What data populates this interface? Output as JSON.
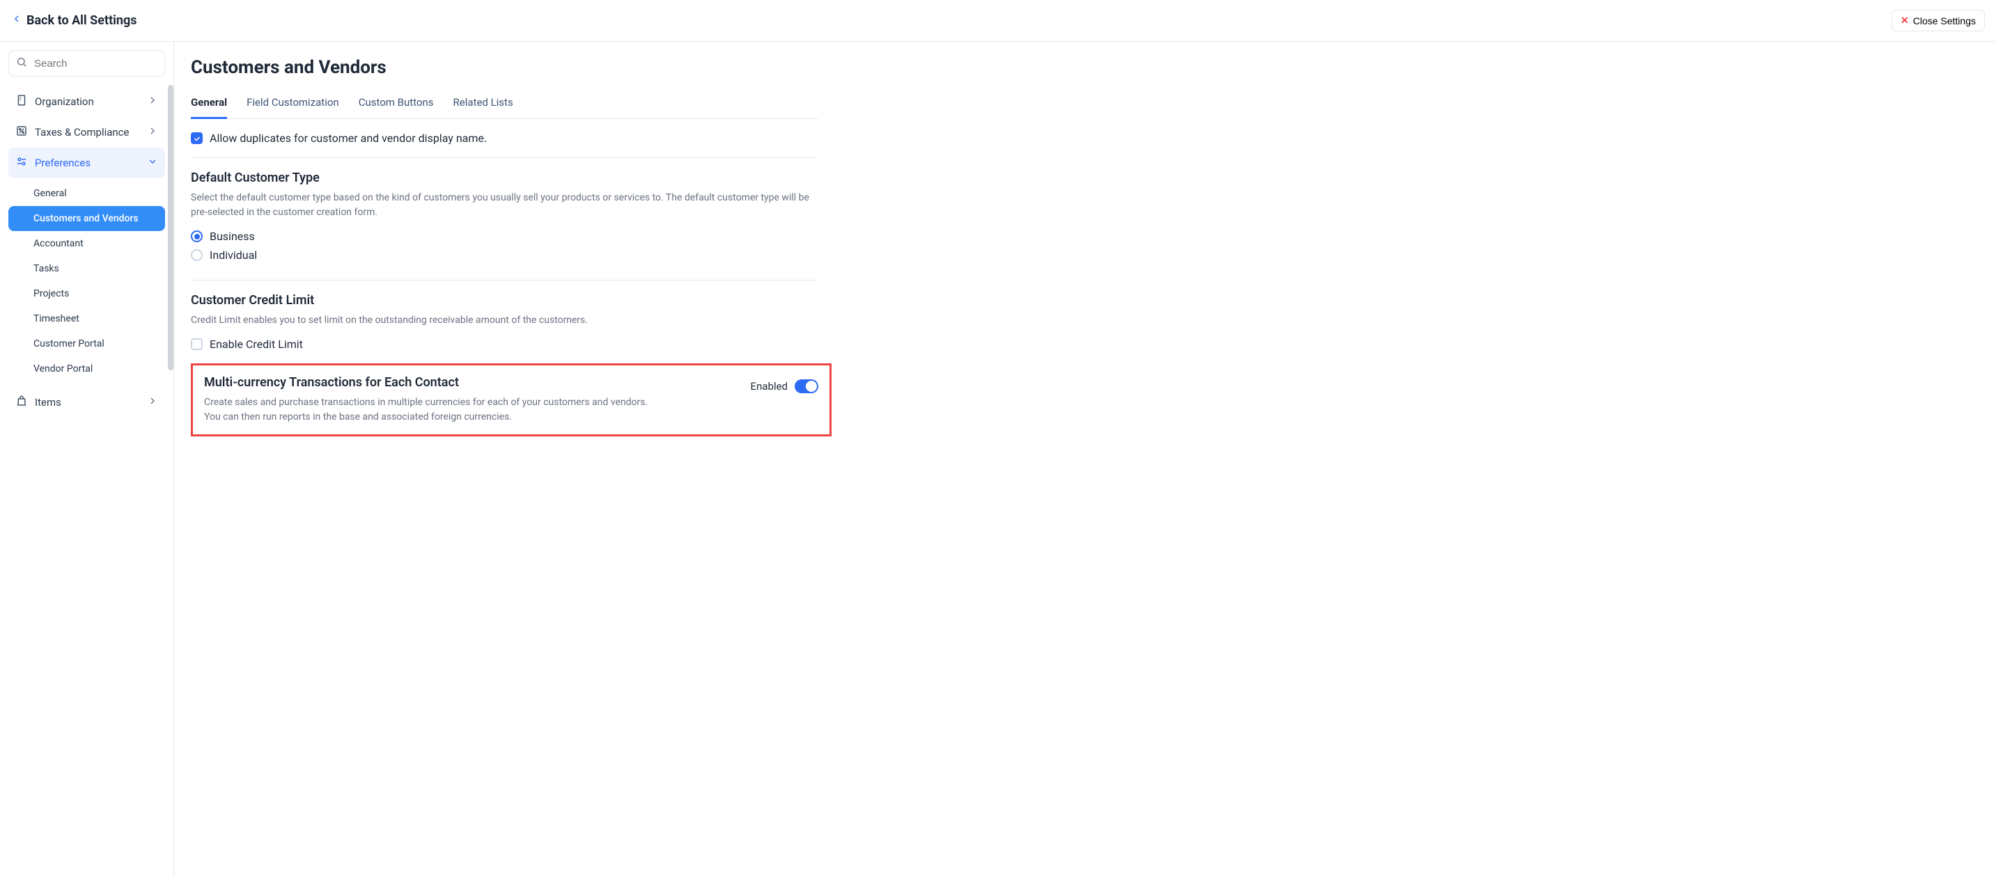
{
  "header": {
    "back_label": "Back to All Settings",
    "close_label": "Close Settings"
  },
  "search": {
    "placeholder": "Search"
  },
  "sidebar": {
    "items": [
      {
        "label": "Organization"
      },
      {
        "label": "Taxes & Compliance"
      },
      {
        "label": "Preferences"
      },
      {
        "label": "Items"
      }
    ],
    "preferences_sub": [
      {
        "label": "General"
      },
      {
        "label": "Customers and Vendors"
      },
      {
        "label": "Accountant"
      },
      {
        "label": "Tasks"
      },
      {
        "label": "Projects"
      },
      {
        "label": "Timesheet"
      },
      {
        "label": "Customer Portal"
      },
      {
        "label": "Vendor Portal"
      }
    ]
  },
  "main": {
    "title": "Customers and Vendors",
    "tabs": [
      "General",
      "Field Customization",
      "Custom Buttons",
      "Related Lists"
    ],
    "allow_dup_label": "Allow duplicates for customer and vendor display name.",
    "default_type": {
      "title": "Default Customer Type",
      "desc": "Select the default customer type based on the kind of customers you usually sell your products or services to. The default customer type will be pre-selected in the customer creation form.",
      "opt_business": "Business",
      "opt_individual": "Individual"
    },
    "credit_limit": {
      "title": "Customer Credit Limit",
      "desc": "Credit Limit enables you to set limit on the outstanding receivable amount of the customers.",
      "enable_label": "Enable Credit Limit"
    },
    "multicurrency": {
      "title": "Multi-currency Transactions for Each Contact",
      "desc": "Create sales and purchase transactions in multiple currencies for each of your customers and vendors. You can then run reports in the base and associated foreign currencies.",
      "status": "Enabled"
    }
  }
}
